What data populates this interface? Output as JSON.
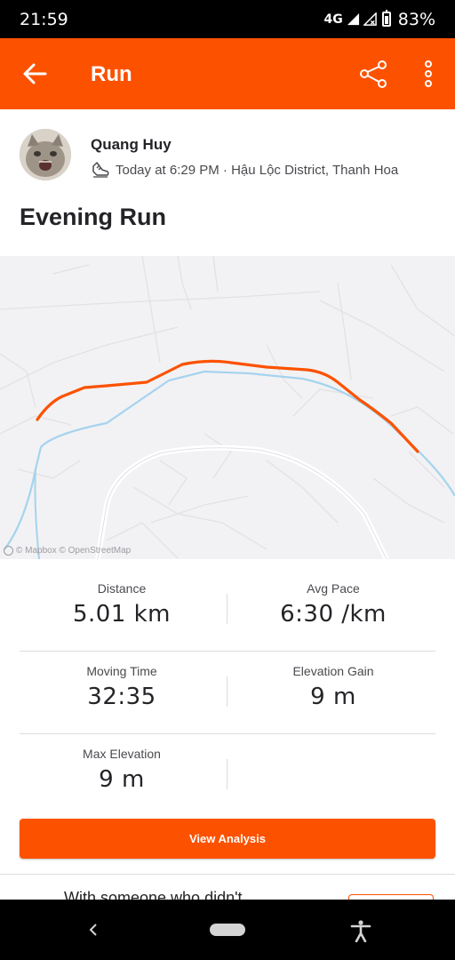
{
  "status_bar": {
    "time": "21:59",
    "network": "4G",
    "battery": "83%"
  },
  "app_bar": {
    "title": "Run",
    "icons": [
      "back-arrow-icon",
      "share-icon",
      "more-vert-icon"
    ]
  },
  "activity": {
    "athlete": "Quang Huy",
    "meta": "Today at 6:29 PM · Hậu Lộc District, Thanh Hoa",
    "title": "Evening Run"
  },
  "map": {
    "credit": "© Mapbox © OpenStreetMap",
    "route_color": "#fc5200",
    "river_color": "#a6d3ee"
  },
  "stats": [
    [
      {
        "label": "Distance",
        "value": "5.01 km"
      },
      {
        "label": "Avg Pace",
        "value": "6:30 /km"
      }
    ],
    [
      {
        "label": "Moving Time",
        "value": "32:35"
      },
      {
        "label": "Elevation Gain",
        "value": "9 m"
      }
    ],
    [
      {
        "label": "Max Elevation",
        "value": "9 m"
      }
    ]
  ],
  "cta": {
    "label": "View Analysis"
  },
  "peek": {
    "text": "With someone who didn't"
  },
  "colors": {
    "accent": "#fc5200",
    "text": "#242428",
    "muted": "#4a4a4f"
  }
}
